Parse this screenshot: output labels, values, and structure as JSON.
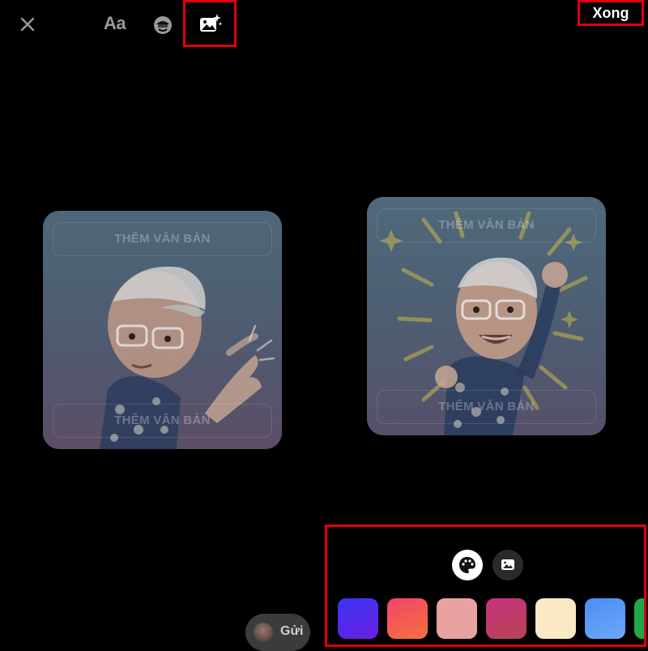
{
  "toolbar": {
    "close_icon": "close-icon",
    "text_tool_label": "Aa",
    "sticker_icon": "sticker-icon",
    "image_generate_icon": "image-sparkle-icon",
    "done_label": "Xong"
  },
  "cards": [
    {
      "top_slot": "THÊM VĂN BẢN",
      "bottom_slot": "THÊM VĂN BẢN"
    },
    {
      "top_slot": "THÊM VĂN BẢN",
      "bottom_slot": "THÊM VĂN BẢN"
    }
  ],
  "background_panel": {
    "modes": [
      "palette-icon",
      "image-icon"
    ],
    "selected_mode": "palette-icon",
    "swatches": [
      "#4b2ff0",
      "#f24a5c",
      "#e8a3a0",
      "#b83a74",
      "#fbe9c6",
      "#5b9cf6",
      "#1ea84a"
    ]
  },
  "send": {
    "label": "Gửi"
  }
}
